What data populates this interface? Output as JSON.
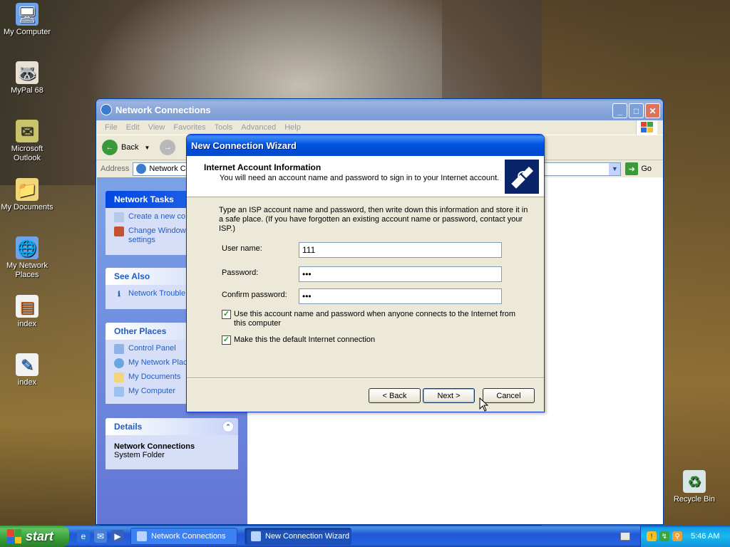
{
  "desktop": {
    "icons": [
      {
        "label": "My Computer",
        "icon": "computer-icon"
      },
      {
        "label": "MyPal 68",
        "icon": "raccoon-icon"
      },
      {
        "label": "Microsoft Outlook",
        "icon": "outlook-icon"
      },
      {
        "label": "My Documents",
        "icon": "folder-icon"
      },
      {
        "label": "My Network Places",
        "icon": "network-icon"
      },
      {
        "label": "index",
        "icon": "html-file-icon"
      },
      {
        "label": "index",
        "icon": "image-file-icon"
      },
      {
        "label": "Recycle Bin",
        "icon": "recycle-bin-icon"
      }
    ]
  },
  "explorer": {
    "title": "Network Connections",
    "menu": [
      "File",
      "Edit",
      "View",
      "Favorites",
      "Tools",
      "Advanced",
      "Help"
    ],
    "back_label": "Back",
    "address_label": "Address",
    "address_value": "Network Co",
    "go_label": "Go",
    "network_tasks": {
      "title": "Network Tasks",
      "items": [
        "Create a new co",
        "Change Window",
        "settings"
      ]
    },
    "see_also": {
      "title": "See Also",
      "items": [
        "Network Trouble"
      ]
    },
    "other_places": {
      "title": "Other Places",
      "items": [
        "Control Panel",
        "My Network Plac",
        "My Documents",
        "My Computer"
      ]
    },
    "details": {
      "title": "Details",
      "name": "Network Connections",
      "type": "System Folder"
    }
  },
  "wizard": {
    "title": "New Connection Wizard",
    "header_title": "Internet Account Information",
    "header_subtitle": "You will need an account name and password to sign in to your Internet account.",
    "intro": "Type an ISP account name and password, then write down this information and store it in a safe place. (If you have forgotten an existing account name or password, contact your ISP.)",
    "fields": {
      "username_label": "User name:",
      "username_value": "111",
      "password_label": "Password:",
      "password_value": "•••",
      "confirm_label": "Confirm password:",
      "confirm_value": "•••"
    },
    "checkboxes": {
      "use_account_label": "Use this account  name and password when anyone connects to the Internet from this computer",
      "use_account_checked": true,
      "default_label": "Make this the default Internet connection",
      "default_checked": true
    },
    "buttons": {
      "back": "< Back",
      "next": "Next >",
      "cancel": "Cancel"
    }
  },
  "taskbar": {
    "start_label": "start",
    "tasks": [
      "Network Connections",
      "New Connection Wizard"
    ],
    "active_task": "New Connection Wizard",
    "clock": "5:46 AM"
  }
}
